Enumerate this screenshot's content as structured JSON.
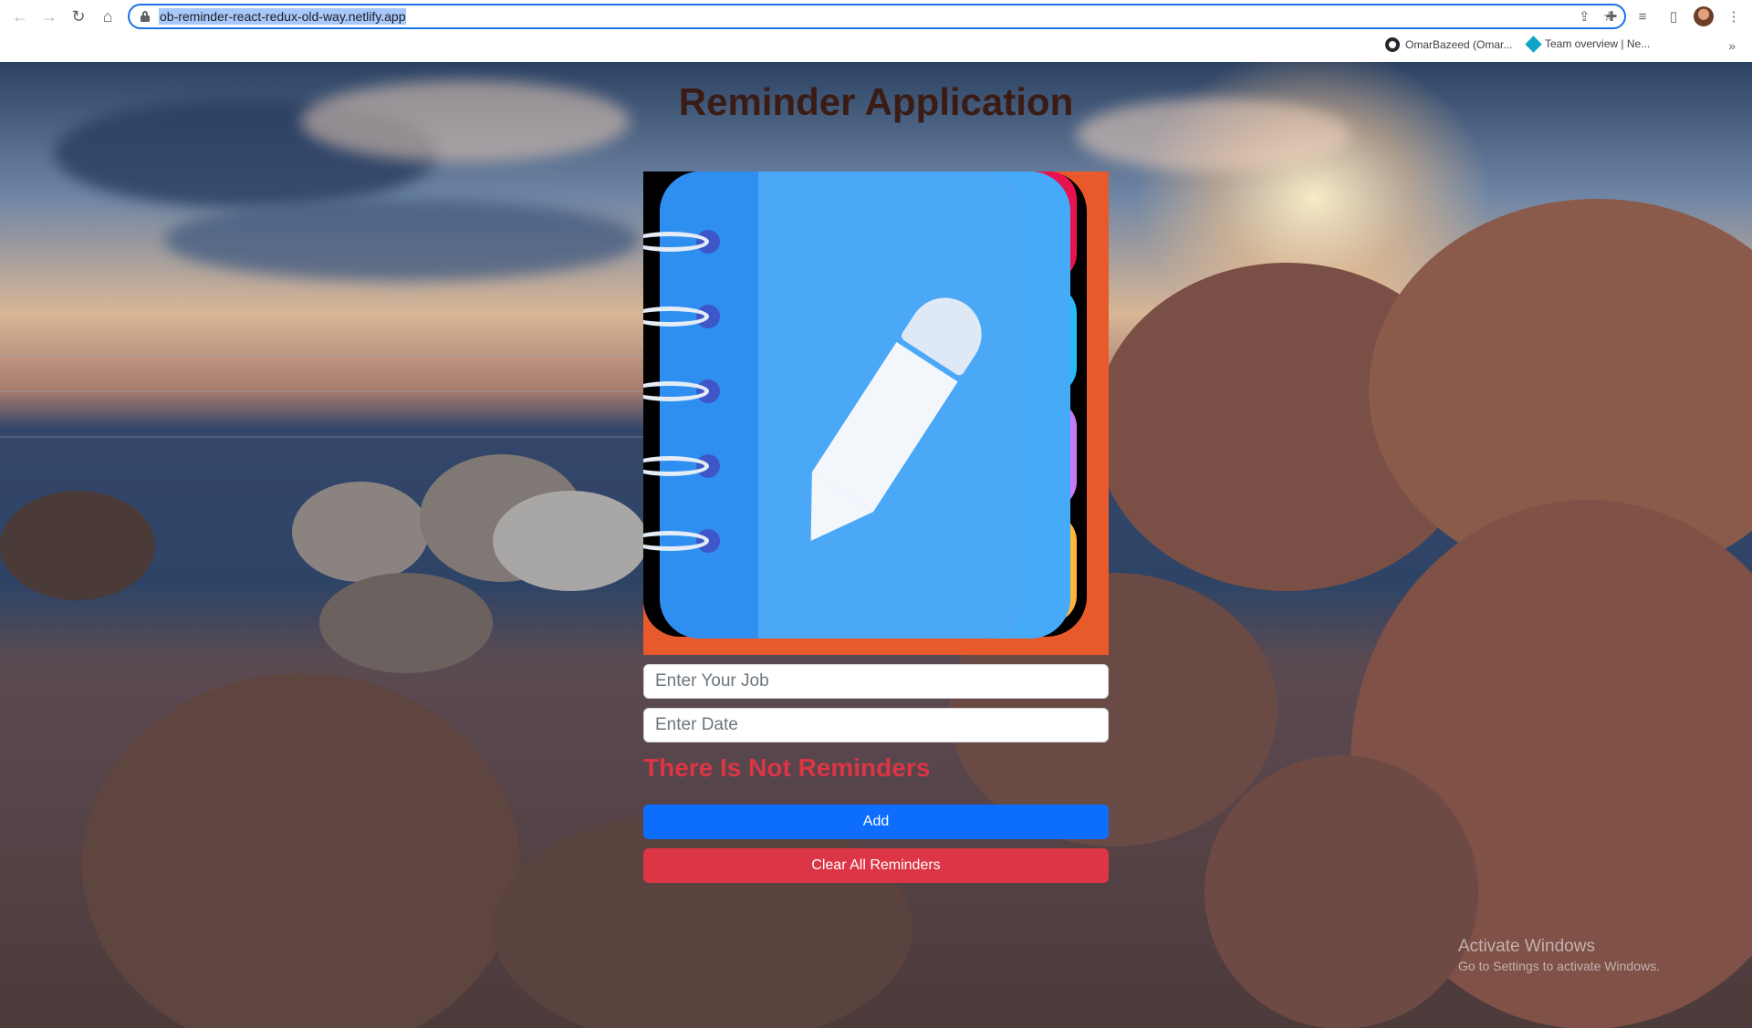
{
  "browser": {
    "url": "ob-reminder-react-redux-old-way.netlify.app",
    "bookmarks": [
      {
        "label": "OmarBazeed (Omar...",
        "icon": "github-icon"
      },
      {
        "label": "Team overview | Ne...",
        "icon": "azure-devops-icon"
      }
    ],
    "more_bookmarks": "»"
  },
  "app": {
    "title": "Reminder Application",
    "job_placeholder": "Enter Your Job",
    "date_placeholder": "Enter Date",
    "empty_message": "There Is Not Reminders",
    "add_label": "Add",
    "clear_label": "Clear All Reminders"
  },
  "watermark": {
    "title": "Activate Windows",
    "subtitle": "Go to Settings to activate Windows."
  },
  "colors": {
    "accent": "#0d6efd",
    "danger": "#dc3545",
    "title": "#3a1c14",
    "logo_frame": "#e85a2c",
    "tabs": [
      "#e8124f",
      "#2ab9f7",
      "#c77af5",
      "#ffb43a"
    ]
  }
}
